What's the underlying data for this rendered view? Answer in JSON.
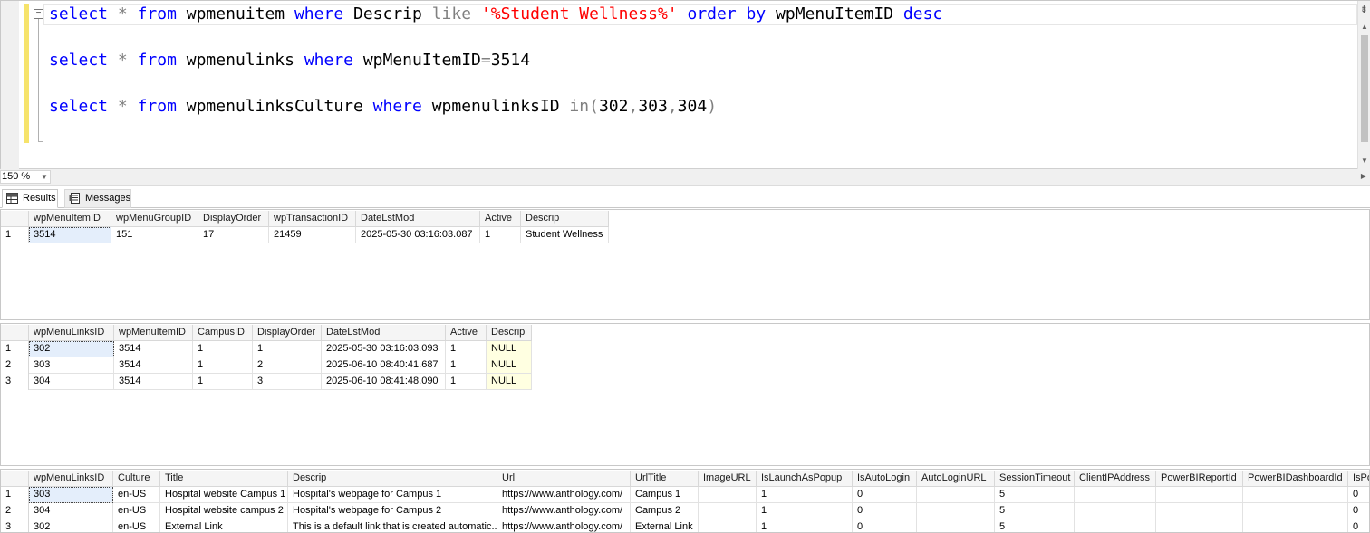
{
  "editor": {
    "fold_glyph": "−",
    "split_glyph": "⇟",
    "lines": [
      {
        "tokens": [
          {
            "t": "select",
            "c": "kw"
          },
          {
            "t": " ",
            "c": ""
          },
          {
            "t": "*",
            "c": "op"
          },
          {
            "t": " ",
            "c": ""
          },
          {
            "t": "from",
            "c": "kw"
          },
          {
            "t": " wpmenuitem ",
            "c": ""
          },
          {
            "t": "where",
            "c": "kw"
          },
          {
            "t": " Descrip ",
            "c": ""
          },
          {
            "t": "like",
            "c": "op"
          },
          {
            "t": " ",
            "c": ""
          },
          {
            "t": "'%Student Wellness%'",
            "c": "str"
          },
          {
            "t": " ",
            "c": ""
          },
          {
            "t": "order by",
            "c": "kw"
          },
          {
            "t": " wpMenuItemID ",
            "c": ""
          },
          {
            "t": "desc",
            "c": "kw"
          }
        ]
      },
      {
        "tokens": [
          {
            "t": "select",
            "c": "kw"
          },
          {
            "t": " ",
            "c": ""
          },
          {
            "t": "*",
            "c": "op"
          },
          {
            "t": " ",
            "c": ""
          },
          {
            "t": "from",
            "c": "kw"
          },
          {
            "t": " wpmenulinks ",
            "c": ""
          },
          {
            "t": "where",
            "c": "kw"
          },
          {
            "t": " wpMenuItemID",
            "c": ""
          },
          {
            "t": "=",
            "c": "op"
          },
          {
            "t": "3514",
            "c": ""
          }
        ]
      },
      {
        "tokens": [
          {
            "t": "select",
            "c": "kw"
          },
          {
            "t": " ",
            "c": ""
          },
          {
            "t": "*",
            "c": "op"
          },
          {
            "t": " ",
            "c": ""
          },
          {
            "t": "from",
            "c": "kw"
          },
          {
            "t": " wpmenulinksCulture ",
            "c": ""
          },
          {
            "t": "where",
            "c": "kw"
          },
          {
            "t": " wpmenulinksID ",
            "c": ""
          },
          {
            "t": "in",
            "c": "op"
          },
          {
            "t": "(",
            "c": "op"
          },
          {
            "t": "302",
            "c": ""
          },
          {
            "t": ",",
            "c": "op"
          },
          {
            "t": "303",
            "c": ""
          },
          {
            "t": ",",
            "c": "op"
          },
          {
            "t": "304",
            "c": ""
          },
          {
            "t": ")",
            "c": "op"
          }
        ]
      }
    ]
  },
  "zoom": {
    "value": "150 %",
    "arrow": "▼"
  },
  "tabs": {
    "results_label": "Results",
    "messages_label": "Messages"
  },
  "colors": {
    "keyword": "#0000ff",
    "operator": "#808080",
    "string": "#ff0000",
    "null_cell": "#ffffe1",
    "selected_cell": "#e4eefb"
  },
  "grids": [
    {
      "columns": [
        "wpMenuItemID",
        "wpMenuGroupID",
        "DisplayOrder",
        "wpTransactionID",
        "DateLstMod",
        "Active",
        "Descrip"
      ],
      "rows": [
        [
          "3514",
          "151",
          "17",
          "21459",
          "2025-05-30 03:16:03.087",
          "1",
          "Student Wellness"
        ]
      ],
      "row_numbers": [
        "1"
      ]
    },
    {
      "columns": [
        "wpMenuLinksID",
        "wpMenuItemID",
        "CampusID",
        "DisplayOrder",
        "DateLstMod",
        "Active",
        "Descrip"
      ],
      "rows": [
        [
          "302",
          "3514",
          "1",
          "1",
          "2025-05-30 03:16:03.093",
          "1",
          "NULL"
        ],
        [
          "303",
          "3514",
          "1",
          "2",
          "2025-06-10 08:40:41.687",
          "1",
          "NULL"
        ],
        [
          "304",
          "3514",
          "1",
          "3",
          "2025-06-10 08:41:48.090",
          "1",
          "NULL"
        ]
      ],
      "row_numbers": [
        "1",
        "2",
        "3"
      ]
    },
    {
      "columns": [
        "wpMenuLinksID",
        "Culture",
        "Title",
        "Descrip",
        "Url",
        "UrlTitle",
        "ImageURL",
        "IsLaunchAsPopup",
        "IsAutoLogin",
        "AutoLoginURL",
        "SessionTimeout",
        "ClientIPAddress",
        "PowerBIReportId",
        "PowerBIDashboardId",
        "IsPo"
      ],
      "rows": [
        [
          "303",
          "en-US",
          "Hospital website Campus 1",
          "Hospital's webpage for Campus 1",
          "https://www.anthology.com/",
          "Campus 1",
          "",
          "1",
          "0",
          "",
          "5",
          "",
          "",
          "",
          "0"
        ],
        [
          "304",
          "en-US",
          "Hospital website campus 2",
          "Hospital's webpage for Campus 2",
          "https://www.anthology.com/",
          "Campus 2",
          "",
          "1",
          "0",
          "",
          "5",
          "",
          "",
          "",
          "0"
        ],
        [
          "302",
          "en-US",
          "External Link",
          "This is a default link that is created automatic...",
          "https://www.anthology.com/",
          "External Link",
          "",
          "1",
          "0",
          "",
          "5",
          "",
          "",
          "",
          "0"
        ]
      ],
      "row_numbers": [
        "1",
        "2",
        "3"
      ]
    }
  ]
}
